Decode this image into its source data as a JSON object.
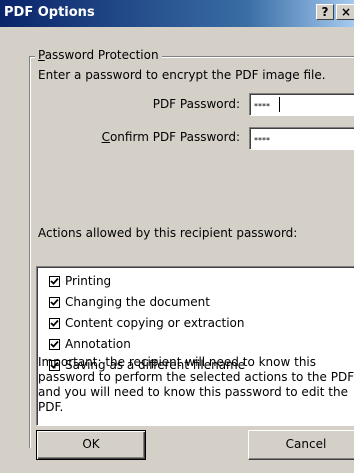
{
  "window": {
    "title": "PDF Options",
    "help_label": "?",
    "close_label": "×"
  },
  "group": {
    "legend_first": "P",
    "legend_rest": "assword Protection",
    "info_text": "Enter a password to encrypt the PDF image file."
  },
  "password": {
    "label": "PDF Password:",
    "value": "****"
  },
  "confirm": {
    "label_first": "C",
    "label_rest": "onfirm PDF Password:",
    "value": "****"
  },
  "actions": {
    "label": "Actions allowed by this recipient password:",
    "items": [
      {
        "label": "Printing",
        "checked": true
      },
      {
        "label": "Changing the document",
        "checked": true
      },
      {
        "label": "Content copying or extraction",
        "checked": true
      },
      {
        "label": "Annotation",
        "checked": true
      },
      {
        "label": "Saving as a different filename",
        "checked": true
      }
    ]
  },
  "note": "Important:  the recipient will need to know this password to perform the selected actions to the PDF and you will need to know this password to edit the PDF.",
  "buttons": {
    "ok": "OK",
    "cancel": "Cancel"
  }
}
